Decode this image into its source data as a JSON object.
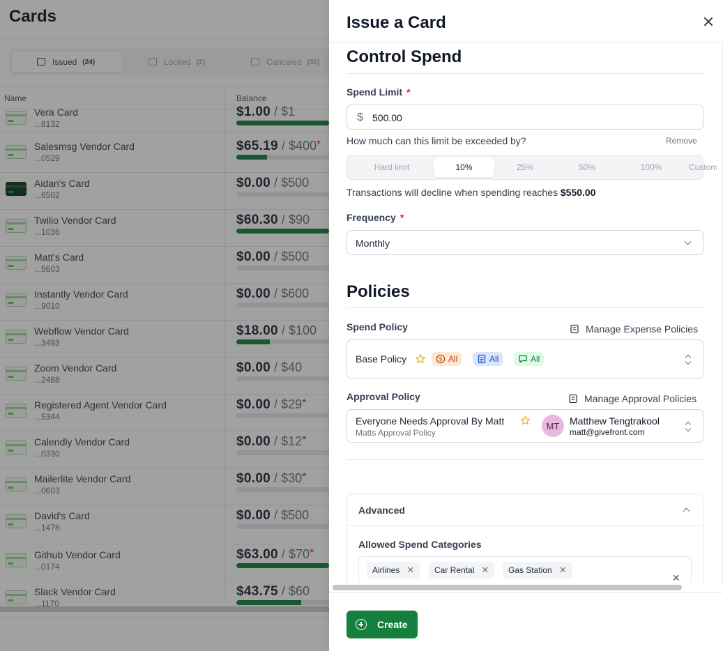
{
  "background": {
    "page_title": "Cards",
    "tabs": [
      {
        "label": "Issued",
        "count": "(24)"
      },
      {
        "label": "Locked",
        "count": "(2)"
      },
      {
        "label": "Canceled",
        "count": "(32)"
      }
    ],
    "columns": {
      "name": "Name",
      "balance": "Balance"
    },
    "rows": [
      {
        "name": "Vera Card",
        "number": "...8132",
        "amount": "$1.00",
        "limit": "$1",
        "over": "",
        "progress": 1.0,
        "dark": false
      },
      {
        "name": "Salesmsg Vendor Card",
        "number": "...0529",
        "amount": "$65.19",
        "limit": "$400",
        "over": "*",
        "progress": 0.33,
        "dark": false
      },
      {
        "name": "Aidan's Card",
        "number": "...6502",
        "amount": "$0.00",
        "limit": "$500",
        "over": "",
        "progress": 0,
        "dark": true
      },
      {
        "name": "Twilio Vendor Card",
        "number": "...1036",
        "amount": "$60.30",
        "limit": "$90",
        "over": "",
        "progress": 1.0,
        "dark": false
      },
      {
        "name": "Matt's Card",
        "number": "...5603",
        "amount": "$0.00",
        "limit": "$500",
        "over": "",
        "progress": 0,
        "dark": false
      },
      {
        "name": "Instantly Vendor Card",
        "number": "...9010",
        "amount": "$0.00",
        "limit": "$600",
        "over": "",
        "progress": 0,
        "dark": false
      },
      {
        "name": "Webflow Vendor Card",
        "number": "...3493",
        "amount": "$18.00",
        "limit": "$100",
        "over": "",
        "progress": 0.36,
        "dark": false
      },
      {
        "name": "Zoom Vendor Card",
        "number": "...2488",
        "amount": "$0.00",
        "limit": "$40",
        "over": "",
        "progress": 0,
        "dark": false
      },
      {
        "name": "Registered Agent Vendor Card",
        "number": "...5344",
        "amount": "$0.00",
        "limit": "$29",
        "over": "*",
        "progress": 0,
        "dark": false
      },
      {
        "name": "Calendly Vendor Card",
        "number": "...0330",
        "amount": "$0.00",
        "limit": "$12",
        "over": "*",
        "progress": 0,
        "dark": false
      },
      {
        "name": "Mailerlite Vendor Card",
        "number": "...0603",
        "amount": "$0.00",
        "limit": "$30",
        "over": "*",
        "progress": 0,
        "dark": false
      },
      {
        "name": "David's Card",
        "number": "...1478",
        "amount": "$0.00",
        "limit": "$500",
        "over": "",
        "progress": 0,
        "dark": false
      },
      {
        "name": "Github Vendor Card",
        "number": "...0174",
        "amount": "$63.00",
        "limit": "$70",
        "over": "*",
        "progress": 1.0,
        "dark": false
      },
      {
        "name": "Slack Vendor Card",
        "number": "...1170",
        "amount": "$43.75",
        "limit": "$60",
        "over": "",
        "progress": 0.7,
        "dark": false
      }
    ]
  },
  "drawer": {
    "title": "Issue a Card",
    "control_spend": {
      "heading": "Control Spend",
      "spend_limit_label": "Spend Limit",
      "required_mark": "*",
      "currency_symbol": "$",
      "spend_limit_value": "500.00",
      "exceed_question": "How much can this limit be exceeded by?",
      "remove_label": "Remove",
      "exceed_options": [
        "Hard limit",
        "10%",
        "25%",
        "50%",
        "100%",
        "Custom"
      ],
      "exceed_selected": "10%",
      "decline_text": "Transactions will decline when spending reaches",
      "decline_amount": "$550.00",
      "frequency_label": "Frequency",
      "frequency_value": "Monthly"
    },
    "policies": {
      "heading": "Policies",
      "spend_policy_label": "Spend Policy",
      "manage_expense_label": "Manage Expense Policies",
      "spend_policy_value": "Base Policy",
      "spend_pills": [
        {
          "icon": "dollar-circle-icon",
          "label": "All",
          "bg": "#fde8d4",
          "fg": "#c2410c"
        },
        {
          "icon": "receipt-icon",
          "label": "All",
          "bg": "#dbe5fb",
          "fg": "#1d4ed8"
        },
        {
          "icon": "comment-icon",
          "label": "All",
          "bg": "#dcfce7",
          "fg": "#15803d"
        }
      ],
      "approval_policy_label": "Approval Policy",
      "manage_approval_label": "Manage Approval Policies",
      "approval_policy_value": "Everyone Needs Approval By Matt",
      "approval_policy_sub": "Matts Approval Policy",
      "approver_initials": "MT",
      "approver_name": "Matthew Tengtrakool",
      "approver_email": "matt@givefront.com"
    },
    "advanced": {
      "heading": "Advanced",
      "categories_label": "Allowed Spend Categories",
      "categories": [
        "Airlines",
        "Car Rental",
        "Gas Station"
      ]
    },
    "create_label": "Create"
  },
  "colors": {
    "accent": "#15803d",
    "required": "#dc2626",
    "star": "#eab308"
  }
}
